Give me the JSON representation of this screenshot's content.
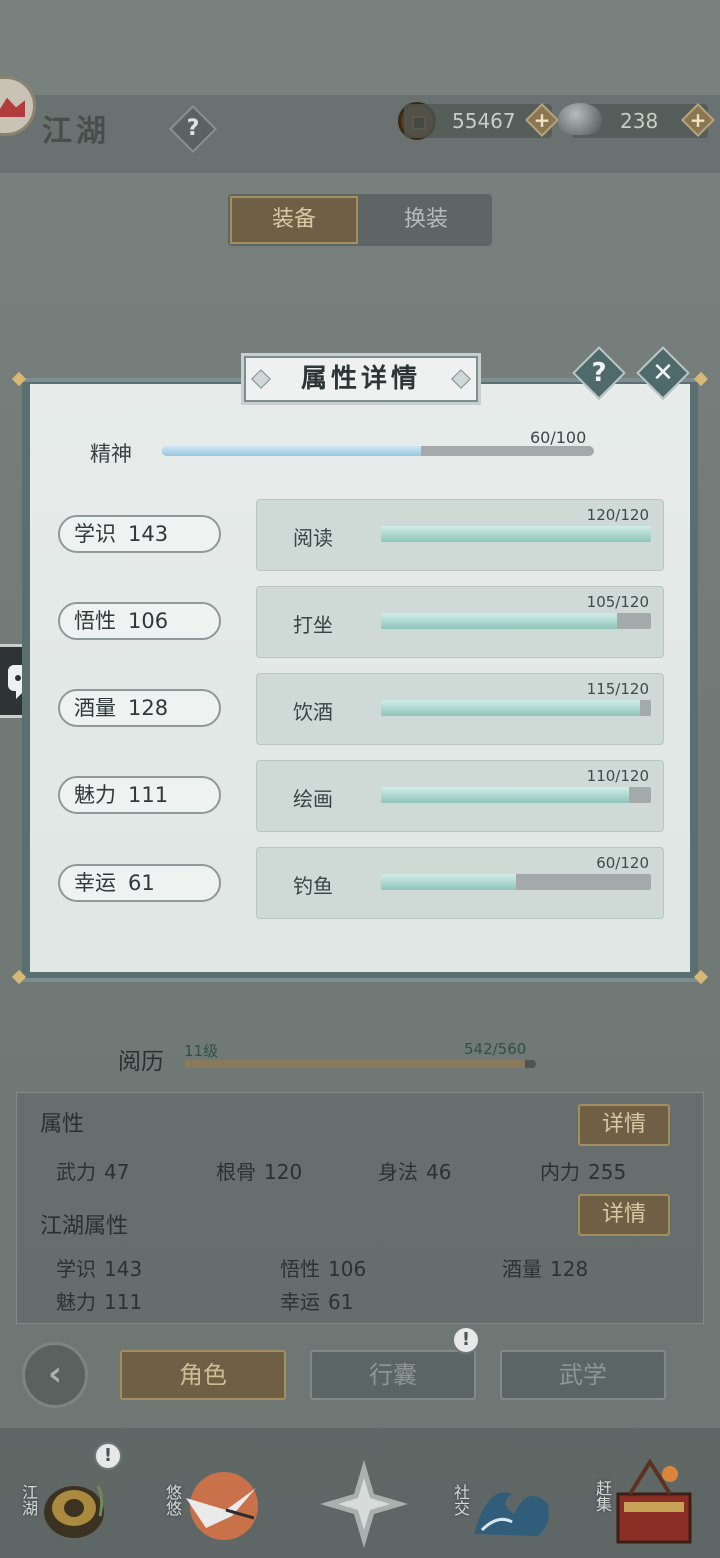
{
  "header": {
    "title": "江湖",
    "help": "?",
    "coins": "55467",
    "silver": "238",
    "plus": "+"
  },
  "tabs": [
    {
      "label": "装备",
      "active": true
    },
    {
      "label": "换装",
      "active": false
    }
  ],
  "modal": {
    "title": "属性详情",
    "help": "?",
    "close": "✕",
    "spirit": {
      "label": "精神",
      "value": "60/100",
      "current": 60,
      "max": 100
    },
    "stats": [
      {
        "label": "学识",
        "value": "143"
      },
      {
        "label": "悟性",
        "value": "106"
      },
      {
        "label": "酒量",
        "value": "128"
      },
      {
        "label": "魅力",
        "value": "111"
      },
      {
        "label": "幸运",
        "value": "61"
      }
    ],
    "skills": [
      {
        "label": "阅读",
        "value": "120/120",
        "current": 120,
        "max": 120
      },
      {
        "label": "打坐",
        "value": "105/120",
        "current": 105,
        "max": 120
      },
      {
        "label": "饮酒",
        "value": "115/120",
        "current": 115,
        "max": 120
      },
      {
        "label": "绘画",
        "value": "110/120",
        "current": 110,
        "max": 120
      },
      {
        "label": "钓鱼",
        "value": "60/120",
        "current": 60,
        "max": 120
      }
    ]
  },
  "experience": {
    "label": "阅历",
    "level": "11级",
    "value": "542/560",
    "current": 542,
    "max": 560
  },
  "attributes": {
    "heading": "属性",
    "detail": "详情",
    "items": [
      {
        "label": "武力",
        "value": "47"
      },
      {
        "label": "根骨",
        "value": "120"
      },
      {
        "label": "身法",
        "value": "46"
      },
      {
        "label": "内力",
        "value": "255"
      }
    ]
  },
  "jianghu_attributes": {
    "heading": "江湖属性",
    "detail": "详情",
    "items": [
      {
        "label": "学识",
        "value": "143"
      },
      {
        "label": "悟性",
        "value": "106"
      },
      {
        "label": "酒量",
        "value": "128"
      },
      {
        "label": "魅力",
        "value": "111"
      },
      {
        "label": "幸运",
        "value": "61"
      }
    ]
  },
  "nav": {
    "back": "‹",
    "tabs": [
      {
        "label": "角色",
        "active": true
      },
      {
        "label": "行囊",
        "active": false
      },
      {
        "label": "武学",
        "active": false
      }
    ],
    "alert": "!"
  },
  "bottom_bar": [
    {
      "label": "江湖",
      "icon": "lantern-icon"
    },
    {
      "label": "悠悠",
      "icon": "crane-icon"
    },
    {
      "label": "",
      "icon": "star-compass-icon"
    },
    {
      "label": "社交",
      "icon": "wave-icon"
    },
    {
      "label": "赶集",
      "icon": "cart-icon"
    }
  ],
  "colors": {
    "accent_gold": "#a48e5e",
    "bar_teal": "#8fc4bb",
    "bar_blue": "#95c7e1"
  }
}
